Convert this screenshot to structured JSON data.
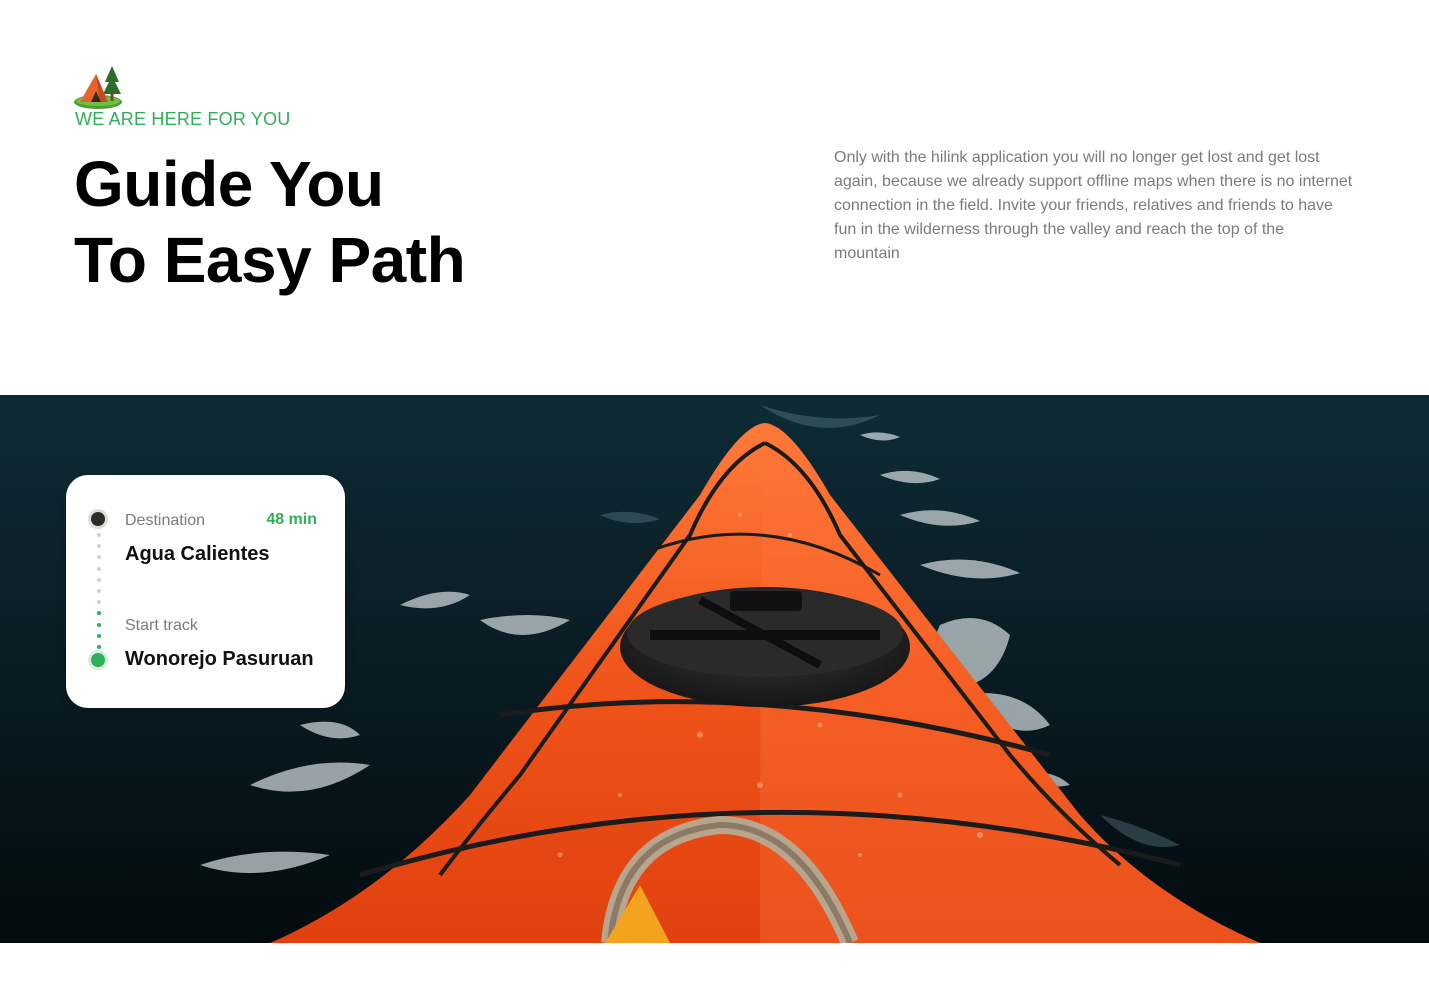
{
  "hero": {
    "icon": "camp-icon",
    "eyebrow": "WE ARE HERE FOR YOU",
    "headline_line1": "Guide You",
    "headline_line2": "To Easy Path",
    "intro": "Only with the hilink application you will no longer get lost and get lost again, because we already support offline maps when there is no internet connection in the field. Invite your friends, relatives and friends to have fun in the wilderness through the valley and reach the top of the mountain"
  },
  "route_card": {
    "destination_label": "Destination",
    "destination_name": "Agua Calientes",
    "eta": "48 min",
    "start_label": "Start track",
    "start_name": "Wonorejo Pasuruan"
  },
  "colors": {
    "accent_green": "#30af5b",
    "text_dark": "#000000",
    "text_muted": "#7b7b7b",
    "kayak_orange": "#f0541a"
  }
}
